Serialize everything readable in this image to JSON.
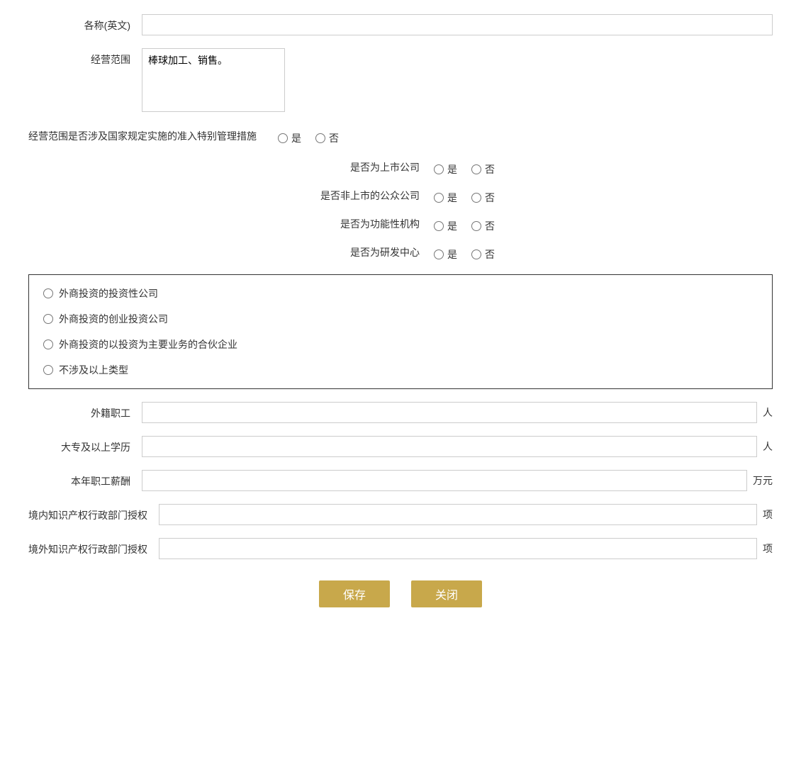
{
  "form": {
    "name_en_label": "各称(英文)",
    "name_en_value": "",
    "biz_scope_label": "经营范围",
    "biz_scope_value": "棒球加工、销售。",
    "special_mgmt_label": "经营范围是否涉及国家规定实施的准入特别管理措施",
    "special_mgmt_yes": "是",
    "special_mgmt_no": "否",
    "listed_label": "是否为上市公司",
    "listed_yes": "是",
    "listed_no": "否",
    "non_listed_public_label": "是否非上市的公众公司",
    "non_listed_public_yes": "是",
    "non_listed_public_no": "否",
    "functional_org_label": "是否为功能性机构",
    "functional_org_yes": "是",
    "functional_org_no": "否",
    "rd_center_label": "是否为研发中心",
    "rd_center_yes": "是",
    "rd_center_no": "否",
    "investment_company_label": "外商投资的投资性公司",
    "venture_company_label": "外商投资的创业投资公司",
    "partnership_label": "外商投资的以投资为主要业务的合伙企业",
    "none_label": "不涉及以上类型",
    "foreign_workers_label": "外籍职工",
    "foreign_workers_value": "",
    "foreign_workers_unit": "人",
    "college_edu_label": "大专及以上学历",
    "college_edu_value": "",
    "college_edu_unit": "人",
    "annual_salary_label": "本年职工薪酬",
    "annual_salary_value": "",
    "annual_salary_unit": "万元",
    "domestic_ip_label": "境内知识产权行政部门授权",
    "domestic_ip_value": "",
    "domestic_ip_unit": "项",
    "foreign_ip_label": "境外知识产权行政部门授权",
    "foreign_ip_value": "",
    "foreign_ip_unit": "项",
    "save_label": "保存",
    "close_label": "关闭"
  }
}
